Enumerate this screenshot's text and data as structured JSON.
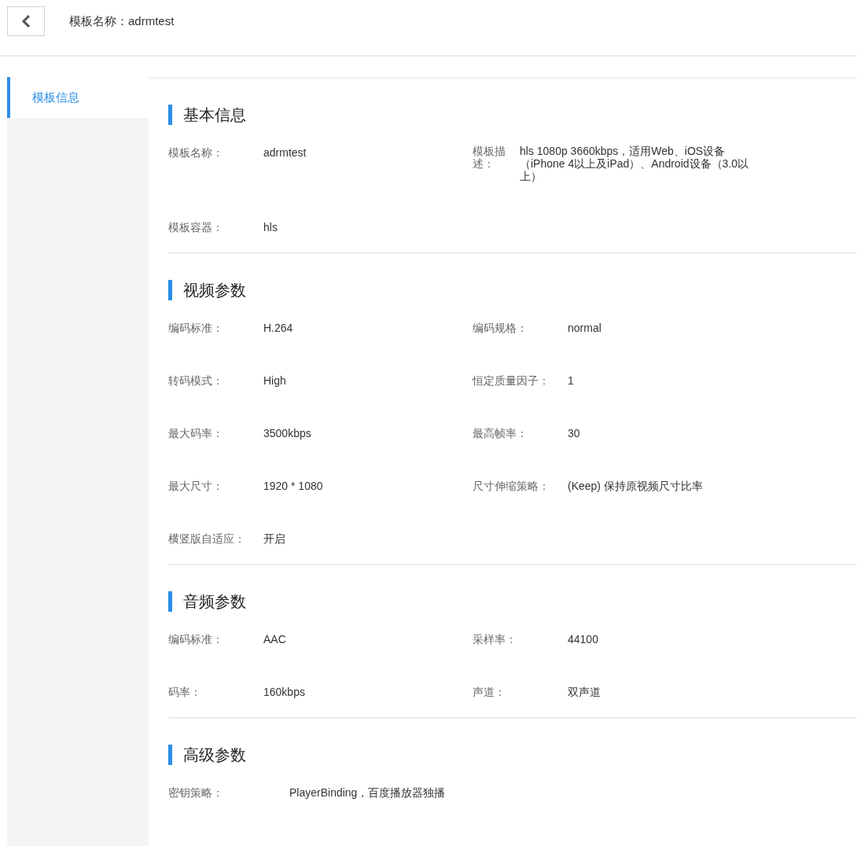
{
  "header": {
    "title": "模板名称：adrmtest"
  },
  "sidebar": {
    "items": [
      {
        "label": "模板信息",
        "selected": true
      }
    ]
  },
  "sections": [
    {
      "title": "基本信息",
      "fields": [
        {
          "kind": "normal",
          "label": "模板名称：",
          "value": "adrmtest"
        },
        {
          "kind": "wrapped",
          "label": "模板描述：",
          "value": "hls 1080p 3660kbps，适用Web、iOS设备（iPhone 4以上及iPad）、Android设备（3.0以上）"
        },
        {
          "kind": "normal",
          "label": "模板容器：",
          "value": "hls"
        }
      ]
    },
    {
      "title": "视频参数",
      "fields": [
        {
          "kind": "normal",
          "label": "编码标准：",
          "value": "H.264"
        },
        {
          "kind": "normal",
          "label": "编码规格：",
          "value": "normal"
        },
        {
          "kind": "normal",
          "label": "转码模式：",
          "value": "High"
        },
        {
          "kind": "normal",
          "label": "恒定质量因子：",
          "value": "1"
        },
        {
          "kind": "normal",
          "label": "最大码率：",
          "value": "3500kbps"
        },
        {
          "kind": "normal",
          "label": "最高帧率：",
          "value": "30"
        },
        {
          "kind": "normal",
          "label": "最大尺寸：",
          "value": "1920 * 1080"
        },
        {
          "kind": "normal",
          "label": "尺寸伸缩策略：",
          "value": "(Keep) 保持原视频尺寸比率"
        },
        {
          "kind": "normal",
          "label": "横竖版自适应：",
          "value": "开启"
        }
      ]
    },
    {
      "title": "音频参数",
      "fields": [
        {
          "kind": "normal",
          "label": "编码标准：",
          "value": "AAC"
        },
        {
          "kind": "normal",
          "label": "采样率：",
          "value": "44100"
        },
        {
          "kind": "normal",
          "label": "码率：",
          "value": "160kbps"
        },
        {
          "kind": "normal",
          "label": "声道：",
          "value": "双声道"
        }
      ]
    },
    {
      "title": "高级参数",
      "fields": [
        {
          "kind": "wide",
          "label": "密钥策略：",
          "value": "PlayerBinding，百度播放器独播"
        }
      ]
    }
  ]
}
